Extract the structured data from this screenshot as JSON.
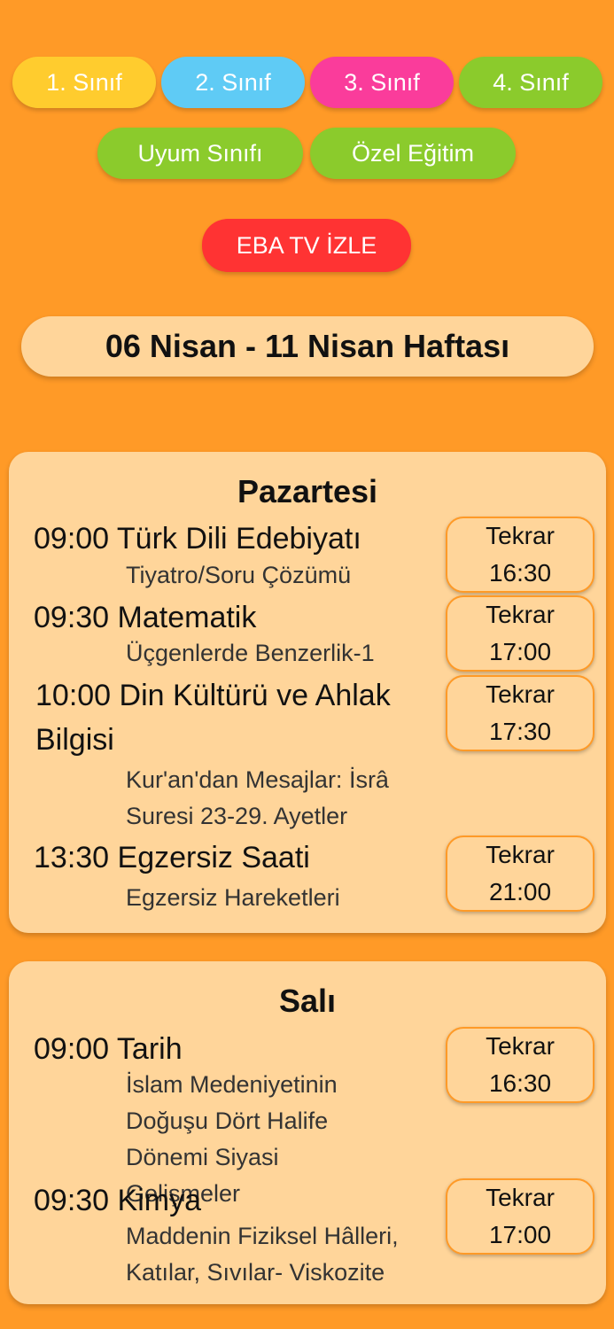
{
  "grade_buttons": [
    {
      "label": "1. Sınıf",
      "color": "#FFCC2E"
    },
    {
      "label": "2. Sınıf",
      "color": "#5FCBF5"
    },
    {
      "label": "3. Sınıf",
      "color": "#FA3C9B"
    },
    {
      "label": "4. Sınıf",
      "color": "#8BCB2C"
    }
  ],
  "extra_buttons": [
    {
      "label": "Uyum Sınıfı",
      "color": "#8BCB2C"
    },
    {
      "label": "Özel Eğitim",
      "color": "#8BCB2C"
    }
  ],
  "eba_tv": {
    "label": "EBA TV İZLE",
    "color": "#FF3333"
  },
  "week_title": "06 Nisan - 11 Nisan Haftası",
  "days": [
    {
      "name": "Pazartesi",
      "lessons": [
        {
          "title": "09:00 Türk Dili Edebiyatı",
          "topic": "Tiyatro/Soru Çözümü",
          "repeat_label": "Tekrar",
          "repeat_time": "16:30"
        },
        {
          "title": "09:30 Matematik",
          "topic": "Üçgenlerde Benzerlik-1",
          "repeat_label": "Tekrar",
          "repeat_time": "17:00"
        },
        {
          "title": "10:00 Din Kültürü ve Ahlak Bilgisi",
          "topic": "Kur'an'dan Mesajlar: İsrâ Suresi 23-29. Ayetler",
          "repeat_label": "Tekrar",
          "repeat_time": "17:30"
        },
        {
          "title": "13:30 Egzersiz Saati",
          "topic": "Egzersiz Hareketleri",
          "repeat_label": "Tekrar",
          "repeat_time": "21:00"
        }
      ]
    },
    {
      "name": "Salı",
      "lessons": [
        {
          "title": "09:00 Tarih",
          "topic": "İslam Medeniyetinin Doğuşu Dört Halife Dönemi Siyasi Gelişmeler",
          "repeat_label": "Tekrar",
          "repeat_time": "16:30"
        },
        {
          "title": "09:30 Kimya",
          "topic": "Maddenin Fiziksel Hâlleri, Katılar, Sıvılar- Viskozite",
          "repeat_label": "Tekrar",
          "repeat_time": "17:00"
        }
      ]
    }
  ],
  "colors": {
    "background": "#FF9A27",
    "card": "#FFD59A",
    "repeat_border": "#FF9A27"
  }
}
